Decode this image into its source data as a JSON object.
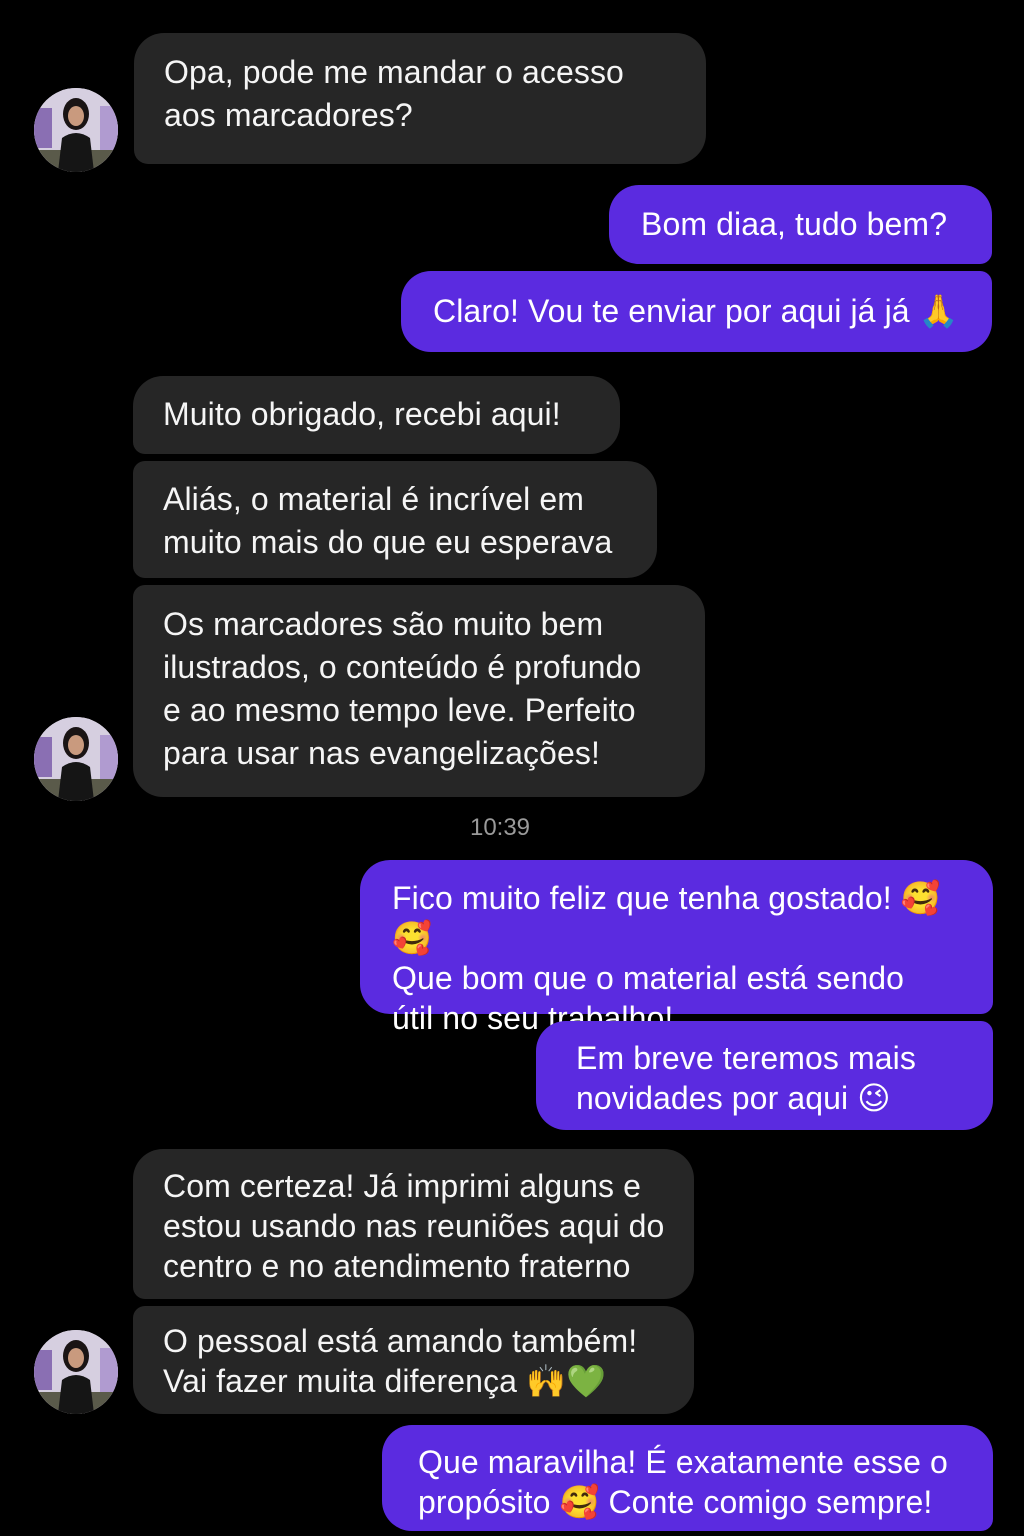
{
  "messages": [
    {
      "from": "them",
      "text": "Opa, pode me mandar o acesso\naos marcadores?"
    },
    {
      "from": "me",
      "text": "Bom diaa, tudo bem?"
    },
    {
      "from": "me",
      "text": "Claro! Vou te enviar por aqui já já 🙏"
    },
    {
      "from": "them",
      "text": "Muito obrigado, recebi aqui!"
    },
    {
      "from": "them",
      "text": "Aliás, o material é incrível em\nmuito mais do que eu esperava"
    },
    {
      "from": "them",
      "text": "Os marcadores são muito bem\nilustrados, o conteúdo é profundo\ne ao mesmo tempo leve. Perfeito\npara usar nas evangelizações!"
    },
    {
      "from": "me",
      "text": "Fico muito feliz que tenha gostado! 🥰🥰\nQue bom que o material está sendo\nútil no seu trabalho!"
    },
    {
      "from": "me",
      "text": "Em breve teremos mais\nnovidades por aqui 😉"
    },
    {
      "from": "them",
      "text": "Com certeza! Já imprimi alguns e\nestou usando nas reuniões aqui do\ncentro e no atendimento fraterno"
    },
    {
      "from": "them",
      "text": "O pessoal está amando também!\nVai fazer muita diferença 🙌💚"
    },
    {
      "from": "me",
      "text": "Que maravilha! É exatamente esse o\npropósito 🥰 Conte comigo sempre!"
    }
  ],
  "timestamp": "10:39",
  "colors": {
    "background": "#000000",
    "incoming_bubble": "#262626",
    "outgoing_bubble": "#5b2be0"
  }
}
